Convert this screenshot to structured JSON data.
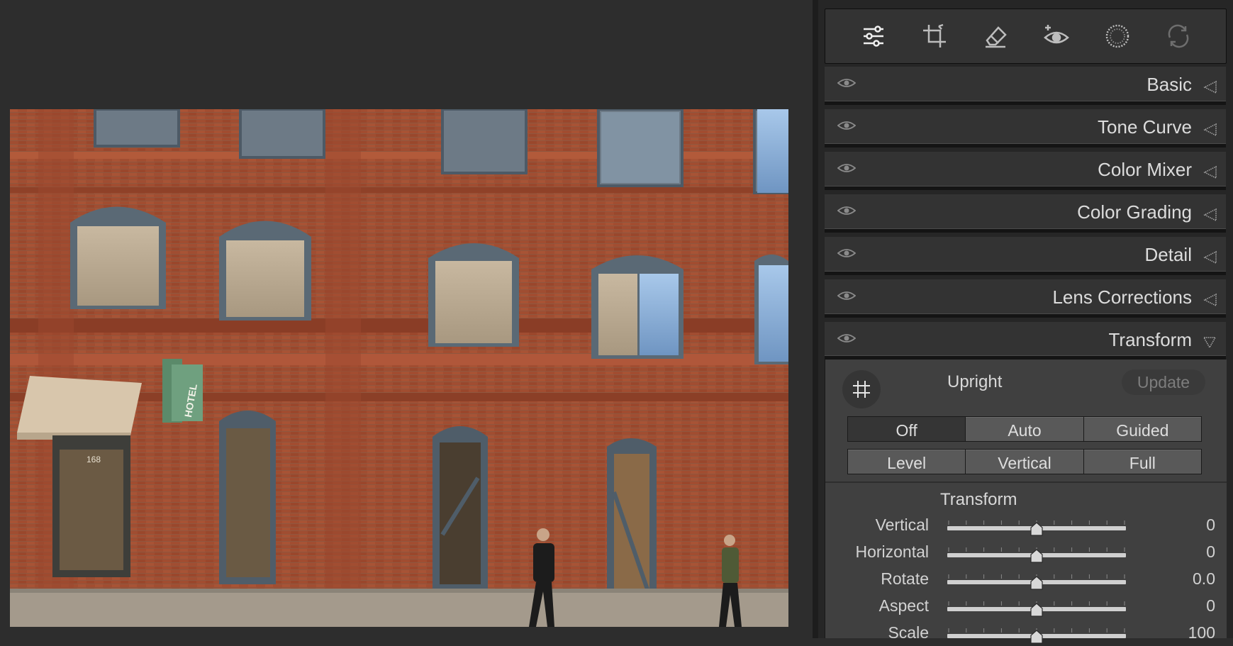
{
  "toolbar": {
    "tools": [
      {
        "name": "edit-sliders-icon"
      },
      {
        "name": "crop-icon"
      },
      {
        "name": "eraser-icon"
      },
      {
        "name": "red-eye-icon"
      },
      {
        "name": "masking-icon"
      },
      {
        "name": "presets-icon"
      }
    ]
  },
  "sections": {
    "basic": "Basic",
    "tone_curve": "Tone Curve",
    "color_mixer": "Color Mixer",
    "color_grading": "Color Grading",
    "detail": "Detail",
    "lens_corrections": "Lens Corrections",
    "transform": "Transform"
  },
  "transform": {
    "upright_label": "Upright",
    "update_label": "Update",
    "upright_options_row1": [
      "Off",
      "Auto",
      "Guided"
    ],
    "upright_options_row2": [
      "Level",
      "Vertical",
      "Full"
    ],
    "active_option": "Off",
    "subsection_title": "Transform",
    "sliders": [
      {
        "label": "Vertical",
        "value": "0",
        "level": 0.5
      },
      {
        "label": "Horizontal",
        "value": "0",
        "level": 0.5
      },
      {
        "label": "Rotate",
        "value": "0.0",
        "level": 0.5
      },
      {
        "label": "Aspect",
        "value": "0",
        "level": 0.5
      },
      {
        "label": "Scale",
        "value": "100",
        "level": 0.5
      }
    ]
  },
  "photo": {
    "sign_text": "HOTEL",
    "address_text": "168"
  }
}
